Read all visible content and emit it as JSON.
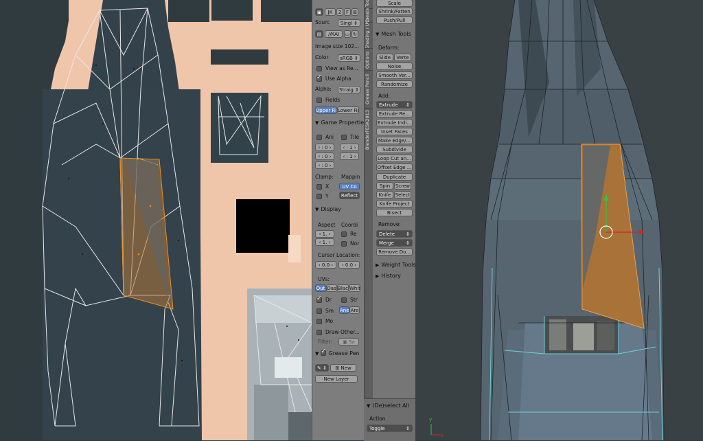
{
  "image_panel": {
    "datablock": {
      "name": "JK",
      "users": "2",
      "fake": "F"
    },
    "source": {
      "label": "Sourc",
      "value": "Singl"
    },
    "filepath": "//KAI",
    "image_size": "Image size 102...",
    "color": {
      "label": "Color",
      "value": "sRGB"
    },
    "view_as_render": "View as Re...",
    "use_alpha": "Use Alpha",
    "alpha": {
      "label": "Alpha:",
      "value": "Straig"
    },
    "fields": "Fields",
    "field_order": {
      "upper": "Upper Fir",
      "lower": "Lower Fir"
    },
    "game_props": {
      "header": "Game Propertie",
      "animated": "Ani",
      "tiles": "Tile",
      "num_a1": "0",
      "num_a2": "0",
      "num_a3": "0",
      "num_b1": "1",
      "num_b2": "1",
      "clamp_label": "Clamp:",
      "mapping_label": "Mappin",
      "clamp_x": "X",
      "clamp_y": "Y",
      "uv_coord": "UV Co",
      "reflect": "Reflect"
    },
    "display": {
      "header": "Display",
      "aspect_label": "Aspect",
      "coords_label": "Coordi",
      "aspect_x": "1.",
      "aspect_y": "1.",
      "repeat": "Re",
      "normalized": "Nor",
      "cursor_label": "Cursor Location:",
      "cursor_x": "0.0",
      "cursor_y": "0.0",
      "uvs_label": "UVs:",
      "styles": [
        "Out",
        "Das",
        "Blac",
        "Whit"
      ],
      "draw_stretch": "Dr",
      "stretch_type": "Str",
      "smooth": "Sm",
      "angle": "Ane",
      "area": "Are",
      "modified": "Mo",
      "draw_other": "Draw Other...",
      "filter_label": "Filter:",
      "filter_value": "Sa"
    },
    "grease_pencil": {
      "header": "Grease Pen",
      "new": "New",
      "new_layer": "New Layer"
    }
  },
  "tabs": [
    "Tools",
    "Create",
    "Shading / UVs",
    "Options",
    "Grease Pencil",
    "BlenderFESK2013"
  ],
  "mesh_tools": {
    "top_buttons": [
      "Scale",
      "Shrink/Fatten",
      "Push/Pull"
    ],
    "header": "Mesh Tools",
    "deform_label": "Deform:",
    "slide": "Slide",
    "vertex": "Verte",
    "noise": "Noise",
    "smooth_vertex": "Smooth Ver...",
    "randomize": "Randomize",
    "add_label": "Add:",
    "extrude": "Extrude",
    "add_buttons": [
      "Extrude Re...",
      "Extrude Indi...",
      "Inset Faces",
      "Make Edge/...",
      "Subdivide",
      "Loop Cut an...",
      "Offset Edge ...",
      "Duplicate"
    ],
    "spin": "Spin",
    "screw": "Screw",
    "knife": "Knife",
    "select": "Select",
    "knife_project": "Knife Project",
    "bisect": "Bisect",
    "remove_label": "Remove:",
    "delete": "Delete",
    "merge": "Merge",
    "remove_doubles": "Remove Do...",
    "weight_tools": "Weight Tools",
    "history": "History"
  },
  "redo_panel": {
    "header": "(De)select All",
    "action_label": "Action",
    "action_value": "Toggle"
  },
  "colors": {
    "selection_orange": "#e8902a",
    "uv_bg_image": "#f2c9ad",
    "panel_gray": "#7d7d7d",
    "active_blue": "#5680c2"
  }
}
